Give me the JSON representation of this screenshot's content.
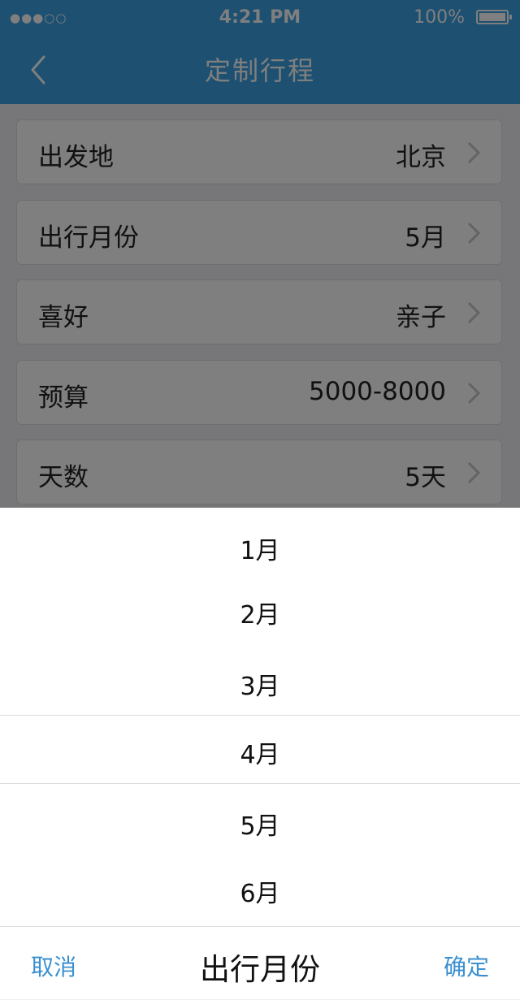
{
  "status_bar": {
    "signal": "●●●○○",
    "time": "4:21 PM",
    "battery": "100%"
  },
  "nav": {
    "title": "定制行程",
    "back_icon": "chevron-left-icon"
  },
  "form": {
    "rows": [
      {
        "label": "出发地",
        "value": "北京"
      },
      {
        "label": "出行月份",
        "value": "5月"
      },
      {
        "label": "喜好",
        "value": "亲子"
      },
      {
        "label": "预算",
        "value": "5000-8000"
      },
      {
        "label": "天数",
        "value": "5天"
      }
    ]
  },
  "picker": {
    "options": [
      "1月",
      "2月",
      "3月",
      "4月",
      "5月",
      "6月"
    ],
    "selected": "4月",
    "cancel": "取消",
    "title": "出行月份",
    "confirm": "确定"
  },
  "colors": {
    "accent": "#3aa0e2",
    "link": "#3a8fd0"
  }
}
